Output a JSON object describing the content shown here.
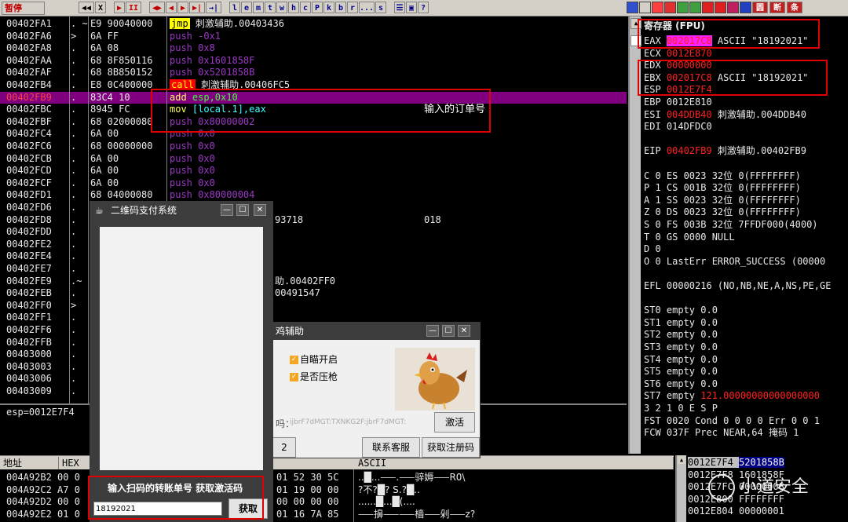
{
  "toolbar": {
    "status": "暂停",
    "buttons": [
      "◀◀",
      "X",
      "▶",
      "II",
      "◀▶",
      "◀",
      "▶",
      "▶|",
      "→|",
      "l",
      "e",
      "m",
      "t",
      "w",
      "h",
      "c",
      "P",
      "k",
      "b",
      "r",
      "...",
      "s",
      "☰",
      "▣",
      "?"
    ],
    "right_buttons": [
      "圆",
      "断",
      "条"
    ]
  },
  "disasm": {
    "rows": [
      {
        "addr": "00402FA1",
        "mk": ". ~",
        "hex": "E9 90040000",
        "op": "jmp",
        "arg": " 刺激辅助.00403436",
        "kind": "jmp",
        "cmt": ""
      },
      {
        "addr": "00402FA6",
        "mk": ">",
        "hex": "6A FF",
        "op": "push",
        "arg": " -0x1",
        "kind": "push",
        "cmt": ""
      },
      {
        "addr": "00402FA8",
        "mk": ".",
        "hex": "6A 08",
        "op": "push",
        "arg": " 0x8",
        "kind": "push",
        "cmt": ""
      },
      {
        "addr": "00402FAA",
        "mk": ".",
        "hex": "68 8F850116",
        "op": "push",
        "arg": " 0x1601858F",
        "kind": "push",
        "cmt": ""
      },
      {
        "addr": "00402FAF",
        "mk": ".",
        "hex": "68 8B850152",
        "op": "push",
        "arg": " 0x5201858B",
        "kind": "push",
        "cmt": ""
      },
      {
        "addr": "00402FB4",
        "mk": ".",
        "hex": "E8 0C400000",
        "op": "call",
        "arg": " 刺激辅助.00406FC5",
        "kind": "call",
        "cmt": ""
      },
      {
        "addr": "00402FB9",
        "mk": ".",
        "hex": "83C4 10",
        "op": "add",
        "arg": " esp,0x10",
        "kind": "add",
        "cmt": "",
        "hl": true
      },
      {
        "addr": "00402FBC",
        "mk": ".",
        "hex": "8945 FC",
        "op": "mov",
        "arg": " [local.1],eax",
        "kind": "mov",
        "cmt": "输入的订单号"
      },
      {
        "addr": "00402FBF",
        "mk": ".",
        "hex": "68 02000080",
        "op": "push",
        "arg": " 0x80000002",
        "kind": "push",
        "cmt": ""
      },
      {
        "addr": "00402FC4",
        "mk": ".",
        "hex": "6A 00",
        "op": "push",
        "arg": " 0x0",
        "kind": "push",
        "cmt": ""
      },
      {
        "addr": "00402FC6",
        "mk": ".",
        "hex": "68 00000000",
        "op": "push",
        "arg": " 0x0",
        "kind": "push",
        "cmt": ""
      },
      {
        "addr": "00402FCB",
        "mk": ".",
        "hex": "6A 00",
        "op": "push",
        "arg": " 0x0",
        "kind": "push",
        "cmt": ""
      },
      {
        "addr": "00402FCD",
        "mk": ".",
        "hex": "6A 00",
        "op": "push",
        "arg": " 0x0",
        "kind": "push",
        "cmt": ""
      },
      {
        "addr": "00402FCF",
        "mk": ".",
        "hex": "6A 00",
        "op": "push",
        "arg": " 0x0",
        "kind": "push",
        "cmt": ""
      },
      {
        "addr": "00402FD1",
        "mk": ".",
        "hex": "68 04000080",
        "op": "push",
        "arg": " 0x80000004",
        "kind": "push",
        "cmt": ""
      },
      {
        "addr": "00402FD6",
        "mk": ".",
        "hex": "",
        "op": "",
        "arg": "",
        "kind": "",
        "cmt": ""
      },
      {
        "addr": "00402FD8",
        "mk": ".",
        "hex": "",
        "op": "",
        "arg": "93718",
        "kind": "plain",
        "cmt": "018"
      },
      {
        "addr": "00402FDD",
        "mk": ".",
        "hex": "",
        "op": "",
        "arg": "",
        "kind": "",
        "cmt": ""
      },
      {
        "addr": "00402FE2",
        "mk": ".",
        "hex": "",
        "op": "",
        "arg": "",
        "kind": "",
        "cmt": ""
      },
      {
        "addr": "00402FE4",
        "mk": ".",
        "hex": "",
        "op": "",
        "arg": "",
        "kind": "",
        "cmt": ""
      },
      {
        "addr": "00402FE7",
        "mk": ".",
        "hex": "",
        "op": "",
        "arg": "",
        "kind": "",
        "cmt": ""
      },
      {
        "addr": "00402FE9",
        "mk": ".~",
        "hex": "",
        "op": "",
        "arg": "助.00402FF0",
        "kind": "plain",
        "cmt": ""
      },
      {
        "addr": "00402FEB",
        "mk": ".",
        "hex": "",
        "op": "",
        "arg": "00491547",
        "kind": "plain",
        "cmt": ""
      },
      {
        "addr": "00402FF0",
        "mk": ">",
        "hex": "",
        "op": "",
        "arg": "",
        "kind": "",
        "cmt": ""
      },
      {
        "addr": "00402FF1",
        "mk": ".",
        "hex": "",
        "op": "",
        "arg": "",
        "kind": "",
        "cmt": ""
      },
      {
        "addr": "00402FF6",
        "mk": ".",
        "hex": "",
        "op": "",
        "arg": "",
        "kind": "",
        "cmt": ""
      },
      {
        "addr": "00402FFB",
        "mk": ".",
        "hex": "",
        "op": "",
        "arg": "",
        "kind": "",
        "cmt": ""
      },
      {
        "addr": "00403000",
        "mk": ".",
        "hex": "",
        "op": "",
        "arg": "",
        "kind": "",
        "cmt": ""
      },
      {
        "addr": "00403003",
        "mk": ".",
        "hex": "",
        "op": "",
        "arg": "",
        "kind": "",
        "cmt": ""
      },
      {
        "addr": "00403006",
        "mk": ".",
        "hex": "",
        "op": "",
        "arg": "",
        "kind": "",
        "cmt": ""
      },
      {
        "addr": "00403009",
        "mk": ".",
        "hex": "",
        "op": "",
        "arg": "",
        "kind": "",
        "cmt": ""
      }
    ],
    "status_line": "esp=0012E7F4"
  },
  "registers": {
    "header": "寄存器 (FPU)",
    "lines": [
      {
        "t": "EAX ",
        "v": "002017C8",
        "vk": "mag",
        "r": " ASCII \"18192021\""
      },
      {
        "t": "ECX ",
        "v": "0012E870",
        "vk": "red",
        "r": ""
      },
      {
        "t": "EDX ",
        "v": "00000000",
        "vk": "red",
        "r": ""
      },
      {
        "t": "EBX ",
        "v": "002017C8",
        "vk": "red",
        "r": " ASCII \"18192021\""
      },
      {
        "t": "ESP ",
        "v": "0012E7F4",
        "vk": "red",
        "r": ""
      },
      {
        "t": "EBP 0012E810",
        "v": "",
        "vk": "",
        "r": ""
      },
      {
        "t": "ESI ",
        "v": "004DDB40",
        "vk": "red",
        "r": " 刺激辅助.004DDB40"
      },
      {
        "t": "EDI 014DFDC0",
        "v": "",
        "vk": "",
        "r": ""
      },
      {
        "t": "",
        "v": "",
        "vk": "",
        "r": ""
      },
      {
        "t": "EIP ",
        "v": "00402FB9",
        "vk": "red",
        "r": " 刺激辅助.00402FB9"
      },
      {
        "t": "",
        "v": "",
        "vk": "",
        "r": ""
      },
      {
        "t": "C 0  ES 0023 32位 0(FFFFFFFF)",
        "v": "",
        "vk": "",
        "r": ""
      },
      {
        "t": "P 1  CS 001B 32位 0(FFFFFFFF)",
        "v": "",
        "vk": "",
        "r": ""
      },
      {
        "t": "A 1  SS 0023 32位 0(FFFFFFFF)",
        "v": "",
        "vk": "",
        "r": ""
      },
      {
        "t": "Z 0  DS 0023 32位 0(FFFFFFFF)",
        "v": "",
        "vk": "",
        "r": ""
      },
      {
        "t": "S 0  FS 003B 32位 7FFDF000(4000)",
        "v": "",
        "vk": "",
        "r": ""
      },
      {
        "t": "T 0  GS 0000 NULL",
        "v": "",
        "vk": "",
        "r": ""
      },
      {
        "t": "D 0",
        "v": "",
        "vk": "",
        "r": ""
      },
      {
        "t": "O 0  LastErr ERROR_SUCCESS (00000",
        "v": "",
        "vk": "",
        "r": ""
      },
      {
        "t": "",
        "v": "",
        "vk": "",
        "r": ""
      },
      {
        "t": "EFL 00000216 (NO,NB,NE,A,NS,PE,GE",
        "v": "",
        "vk": "",
        "r": ""
      },
      {
        "t": "",
        "v": "",
        "vk": "",
        "r": ""
      },
      {
        "t": "ST0 empty 0.0",
        "v": "",
        "vk": "",
        "r": ""
      },
      {
        "t": "ST1 empty 0.0",
        "v": "",
        "vk": "",
        "r": ""
      },
      {
        "t": "ST2 empty 0.0",
        "v": "",
        "vk": "",
        "r": ""
      },
      {
        "t": "ST3 empty 0.0",
        "v": "",
        "vk": "",
        "r": ""
      },
      {
        "t": "ST4 empty 0.0",
        "v": "",
        "vk": "",
        "r": ""
      },
      {
        "t": "ST5 empty 0.0",
        "v": "",
        "vk": "",
        "r": ""
      },
      {
        "t": "ST6 empty 0.0",
        "v": "",
        "vk": "",
        "r": ""
      },
      {
        "t": "ST7 empty ",
        "v": "121.00000000000000000",
        "vk": "red",
        "r": ""
      },
      {
        "t": "               3 2 1 0      E S P",
        "v": "",
        "vk": "",
        "r": ""
      },
      {
        "t": "FST 0020  Cond 0 0 0 0  Err 0 0 1",
        "v": "",
        "vk": "",
        "r": ""
      },
      {
        "t": "FCW 037F  Prec NEAR,64  掩码    1",
        "v": "",
        "vk": "",
        "r": ""
      }
    ]
  },
  "dump": {
    "col_addr": "地址",
    "col_hex": "HEX 数",
    "col_ascii": "ASCII",
    "rows": [
      {
        "addr": "004A92B2",
        "hex": "00 0",
        "mid": "01 52 30 5C",
        "ascii": "..█...⸺.⸺骍媷⸺R0\\"
      },
      {
        "addr": "004A92C2",
        "hex": "A7 0",
        "mid": "01 19 00 00",
        "ascii": "?不?█? S.?█.."
      },
      {
        "addr": "004A92D2",
        "hex": "00 0",
        "mid": "00 00 00 00",
        "ascii": "......█...█(...."
      },
      {
        "addr": "004A92E2",
        "hex": "01 0",
        "mid": "01 16 7A 85",
        "ascii": "⸺擤⸺⸺樯⸺剁⸺z?"
      }
    ]
  },
  "stack": {
    "rows": [
      {
        "a": "0012E7F4",
        "v": "5201858B",
        "sel": true
      },
      {
        "a": "0012E7F8",
        "v": "1601858F",
        "sel": false
      },
      {
        "a": "0012E7FC",
        "v": "00000008",
        "sel": false
      },
      {
        "a": "0012E800",
        "v": "FFFFFFFF",
        "sel": false
      },
      {
        "a": "0012E804",
        "v": "00000001",
        "sel": false
      }
    ],
    "watermark": "小道安全"
  },
  "qr_dialog": {
    "title": "二维码支付系统",
    "instruction": "输入扫码的转账单号 获取激活码",
    "input_value": "18192021",
    "get_button": "获取"
  },
  "chicken_dialog": {
    "title": "鸡辅助",
    "opt1": "自瞄开启",
    "opt2": "是否压枪",
    "code_label": "吗：",
    "code_placeholder": "ijbrF7dMGT:TXNKG2F:jbrF7dMGT:",
    "activate": "激活",
    "tab_partial": "2",
    "contact": "联系客服",
    "get_code": "获取注册码"
  },
  "annotation": {
    "note": "输入的订单号"
  }
}
